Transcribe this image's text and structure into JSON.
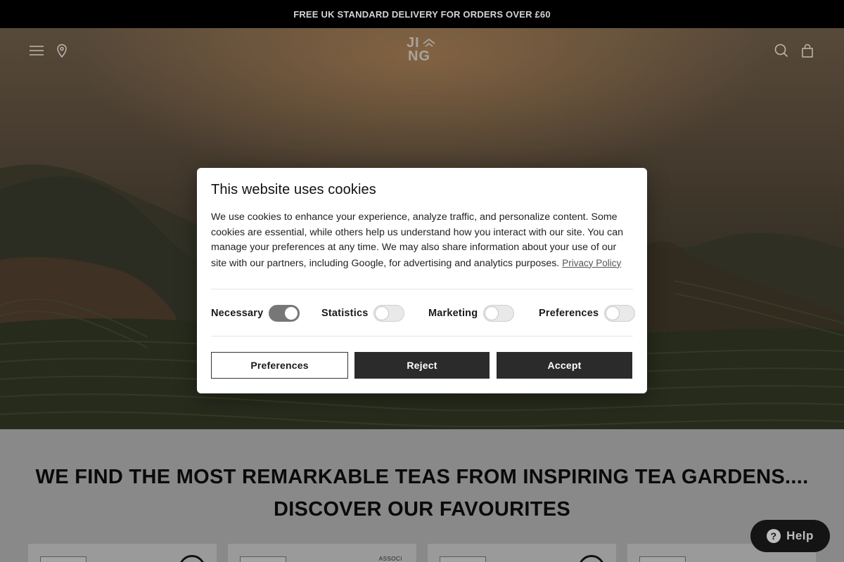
{
  "announcement": {
    "text": "FREE UK STANDARD DELIVERY FOR ORDERS OVER £60"
  },
  "header": {
    "logo_line1": "JI",
    "logo_line2": "NG",
    "icons": [
      "menu-icon",
      "location-pin-icon",
      "search-icon",
      "bag-icon"
    ]
  },
  "headline": {
    "line1": "WE FIND THE MOST REMARKABLE TEAS FROM INSPIRING TEA GARDENS....",
    "line2": "DISCOVER OUR FAVOURITES"
  },
  "cards": [
    {
      "seal_text": ""
    },
    {
      "seal_text": "ASSOCI"
    },
    {
      "seal_text": ""
    },
    {
      "seal_text": ""
    }
  ],
  "help": {
    "label": "Help",
    "icon": "question-icon"
  },
  "cookie": {
    "title": "This website uses cookies",
    "body": "We use cookies to enhance your experience, analyze traffic, and personalize content. Some cookies are essential, while others help us understand how you interact with our site. You can manage your preferences at any time. We may also share information about your use of our site with our partners, including Google, for advertising and analytics purposes.",
    "privacy_link": "Privacy Policy",
    "toggles": [
      {
        "label": "Necessary",
        "on": true
      },
      {
        "label": "Statistics",
        "on": false
      },
      {
        "label": "Marketing",
        "on": false
      },
      {
        "label": "Preferences",
        "on": false
      }
    ],
    "buttons": {
      "preferences": "Preferences",
      "reject": "Reject",
      "accept": "Accept"
    }
  }
}
